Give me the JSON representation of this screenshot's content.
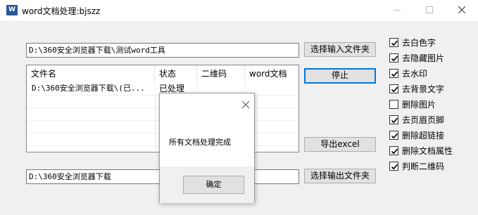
{
  "window": {
    "title": "word文档处理:bjszz",
    "app_icon_text": "W"
  },
  "input_path": {
    "value": "D:\\360安全浏览器下载\\测试word工具",
    "button_label": "选择输入文件夹"
  },
  "output_path": {
    "value": "D:\\360安全浏览器下载",
    "button_label": "选择输出文件夹"
  },
  "buttons": {
    "stop_label": "停止",
    "export_label": "导出excel"
  },
  "file_list": {
    "columns": [
      "文件名",
      "状态",
      "二维码",
      "word文档"
    ],
    "rows": [
      {
        "file_name": "D:\\360安全浏览器下载\\(已...",
        "status": "已处理",
        "qrcode": "",
        "word_doc": ""
      }
    ]
  },
  "options": [
    {
      "label": "去白色字",
      "checked": true
    },
    {
      "label": "去隐藏图片",
      "checked": true
    },
    {
      "label": "去水印",
      "checked": true
    },
    {
      "label": "去背景文字",
      "checked": true
    },
    {
      "label": "删除图片",
      "checked": false
    },
    {
      "label": "去页眉页脚",
      "checked": true
    },
    {
      "label": "删除超链接",
      "checked": true
    },
    {
      "label": "删除文档属性",
      "checked": true
    },
    {
      "label": "判断二维码",
      "checked": true
    }
  ],
  "dialog": {
    "message": "所有文档处理完成",
    "ok_label": "确定"
  },
  "icons": {
    "minimize": "minimize-icon",
    "maximize": "maximize-icon",
    "close": "close-icon",
    "checkmark": "checkmark-icon"
  }
}
